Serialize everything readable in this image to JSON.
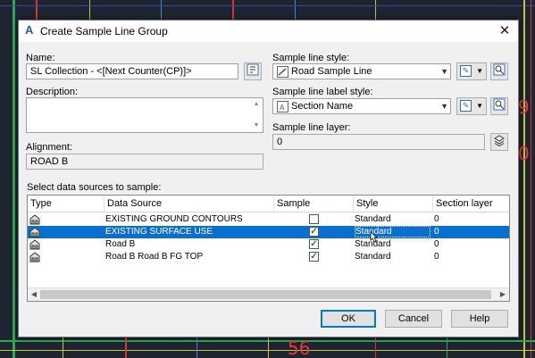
{
  "dialog": {
    "title": "Create Sample Line Group",
    "close_glyph": "✕"
  },
  "name": {
    "label": "Name:",
    "value": "SL Collection - <[Next Counter(CP)]>"
  },
  "description": {
    "label": "Description:",
    "value": ""
  },
  "alignment": {
    "label": "Alignment:",
    "value": "ROAD B"
  },
  "sample_line_style": {
    "label": "Sample line style:",
    "value": "Road Sample Line"
  },
  "sample_line_label_style": {
    "label": "Sample line label style:",
    "value": "Section Name"
  },
  "sample_line_layer": {
    "label": "Sample line layer:",
    "value": "0"
  },
  "sources": {
    "label": "Select data sources to sample:",
    "columns": [
      "Type",
      "Data Source",
      "Sample",
      "Style",
      "Section layer"
    ],
    "rows": [
      {
        "source": "EXISTING GROUND CONTOURS",
        "sample": false,
        "style": "Standard",
        "layer": "0",
        "selected": false
      },
      {
        "source": "EXISTING SURFACE USE",
        "sample": true,
        "style": "Standard",
        "layer": "0",
        "selected": true
      },
      {
        "source": "Road B",
        "sample": true,
        "style": "Standard",
        "layer": "0",
        "selected": false
      },
      {
        "source": "Road B Road B FG TOP",
        "sample": true,
        "style": "Standard",
        "layer": "0",
        "selected": false
      }
    ]
  },
  "buttons": {
    "ok": "OK",
    "cancel": "Cancel",
    "help": "Help"
  },
  "cad_numbers": [
    "9",
    "0",
    "56"
  ],
  "colors": {
    "selection": "#0a6fd0",
    "cad_background": "#1e2430",
    "cad_red": "#e53935"
  }
}
